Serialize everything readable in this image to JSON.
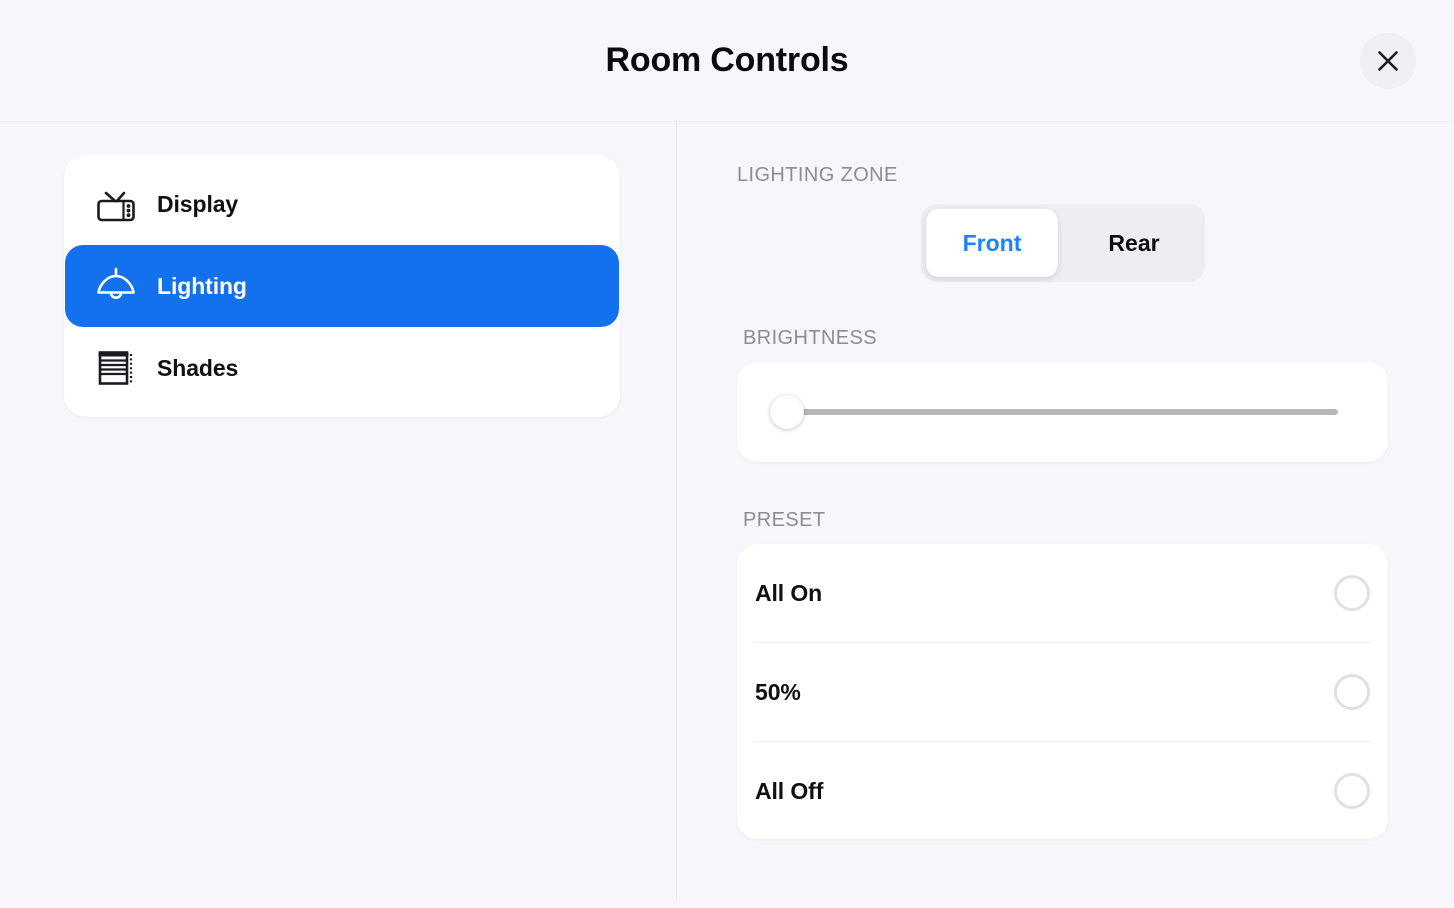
{
  "header": {
    "title": "Room Controls",
    "close_icon": "close-icon"
  },
  "sidebar": {
    "items": [
      {
        "label": "Display",
        "icon": "tv-icon",
        "selected": false
      },
      {
        "label": "Lighting",
        "icon": "lamp-icon",
        "selected": true
      },
      {
        "label": "Shades",
        "icon": "blinds-icon",
        "selected": false
      }
    ]
  },
  "main": {
    "zone": {
      "label": "LIGHTING ZONE",
      "options": [
        "Front",
        "Rear"
      ],
      "selected": "Front"
    },
    "brightness": {
      "label": "BRIGHTNESS",
      "value": 0,
      "min": 0,
      "max": 100
    },
    "preset": {
      "label": "PRESET",
      "rows": [
        {
          "label": "All On",
          "selected": false
        },
        {
          "label": "50%",
          "selected": false
        },
        {
          "label": "All Off",
          "selected": false
        }
      ]
    }
  },
  "colors": {
    "accent": "#1471ee",
    "segment_active_text": "#1a84ff",
    "page_background": "#f7f7fb",
    "card_background": "#ffffff",
    "muted_text": "#8c8c94"
  }
}
